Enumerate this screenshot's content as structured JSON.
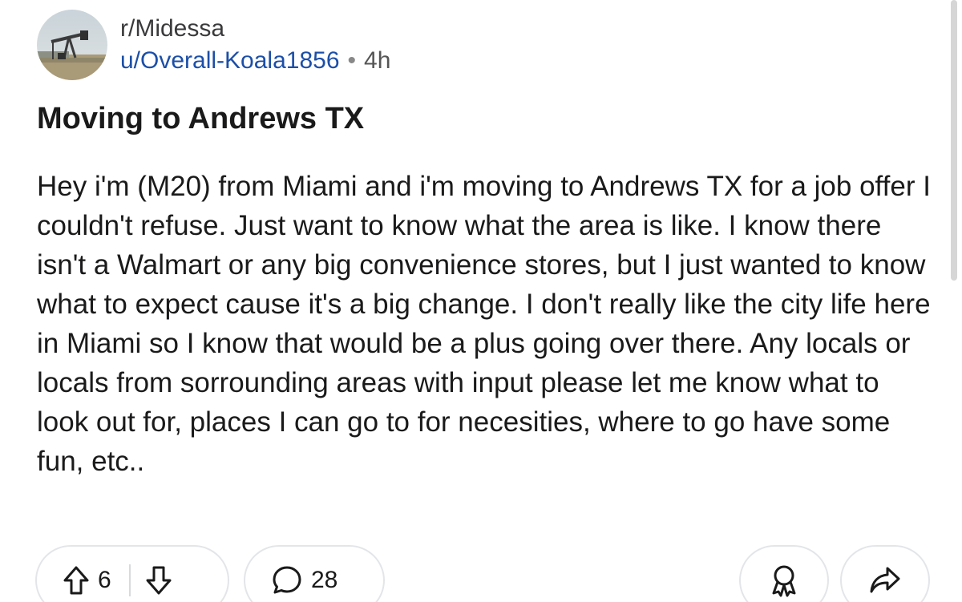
{
  "post": {
    "subreddit": "r/Midessa",
    "author": "u/Overall-Koala1856",
    "separator": "•",
    "time": "4h",
    "title": "Moving to Andrews TX",
    "body": "Hey i'm (M20) from Miami and i'm moving to Andrews TX for a job offer I couldn't refuse. Just want to know what the area is like. I know there isn't a Walmart or any big convenience stores, but I just wanted to know what to expect cause it's a big change. I don't really like the city life here in Miami so I know that would be a plus going over there. Any locals or locals from sorrounding areas with input please let me know what to look out for, places I can go to for necesities, where to go have some fun, etc.."
  },
  "actions": {
    "upvote_count": "6",
    "comment_count": "28",
    "icons": {
      "upvote": "upvote-arrow-icon",
      "downvote": "downvote-arrow-icon",
      "comment": "comment-bubble-icon",
      "award": "award-ribbon-icon",
      "share": "share-arrow-icon"
    }
  },
  "colors": {
    "username": "#1c4fa8",
    "text": "#1a1a1b",
    "pill_border": "#e3e5e8"
  }
}
